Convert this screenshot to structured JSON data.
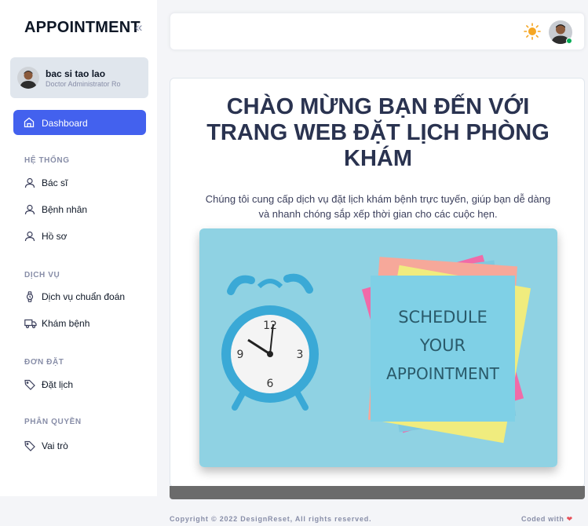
{
  "brand": {
    "title": "APPOINTMENT",
    "collapse_icon": "chevrons-left-icon"
  },
  "profile": {
    "name": "bac si tao lao",
    "role": "Doctor Administrator Ro"
  },
  "nav": {
    "dashboard": "Dashboard",
    "sections": [
      {
        "title": "HỆ THỐNG",
        "items": [
          "Bác sĩ",
          "Bệnh nhân",
          "Hồ sơ"
        ]
      },
      {
        "title": "DỊCH VỤ",
        "items": [
          "Dịch vụ chuẩn đoán",
          "Khám bệnh"
        ]
      },
      {
        "title": "ĐƠN ĐẶT",
        "items": [
          "Đặt lịch"
        ]
      },
      {
        "title": "PHÂN QUYỀN",
        "items": [
          "Vai trò"
        ]
      }
    ]
  },
  "main": {
    "welcome_line1": "CHÀO MỪNG BẠN ĐẾN VỚI",
    "welcome_line2": "TRANG WEB ĐẶT LỊCH PHÒNG",
    "welcome_line3": "KHÁM",
    "desc_line1": "Chúng tôi cung cấp dịch vụ đặt lịch khám bệnh trực tuyến, giúp bạn dễ dàng",
    "desc_line2": "và nhanh chóng sắp xếp thời gian cho các cuộc hẹn.",
    "hero_note": [
      "SCHEDULE",
      "YOUR",
      "APPOINTMENT"
    ]
  },
  "footer": {
    "copyright": "Copyright © 2022 DesignReset, All rights reserved.",
    "coded": "Coded with"
  },
  "colors": {
    "accent": "#4361ee",
    "sun": "#f5a623",
    "heart": "#e7515a",
    "online": "#00ab55"
  }
}
